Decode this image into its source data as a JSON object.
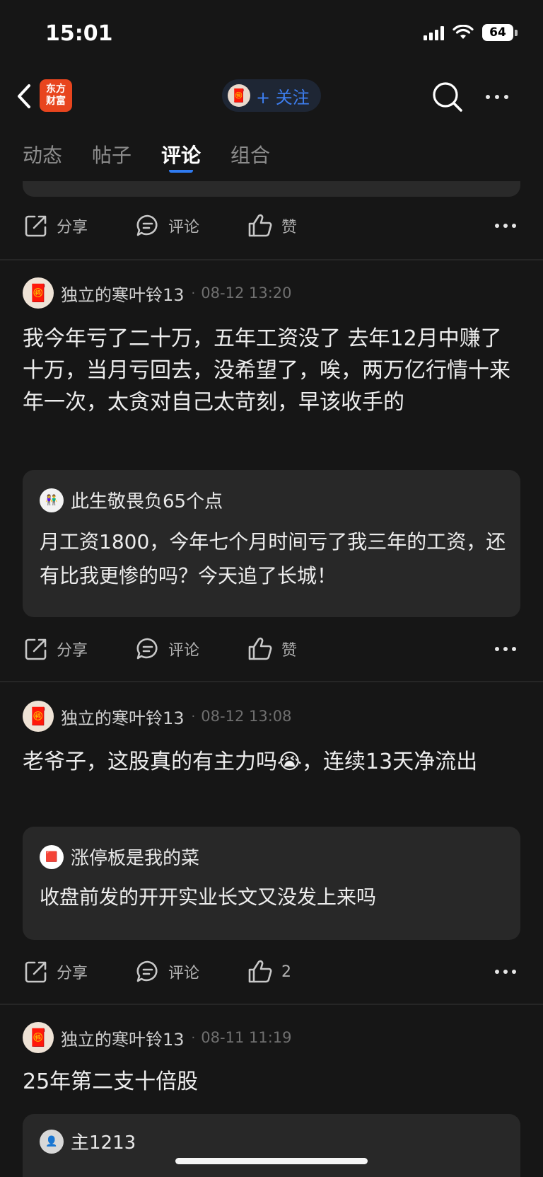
{
  "status_bar": {
    "time": "15:01",
    "battery": "64"
  },
  "nav": {
    "logo_line1": "东方",
    "logo_line2": "财富",
    "follow_label": "+ 关注"
  },
  "tabs": [
    {
      "label": "动态"
    },
    {
      "label": "帖子"
    },
    {
      "label": "评论"
    },
    {
      "label": "组合"
    }
  ],
  "actions": {
    "share": "分享",
    "comment": "评论",
    "like": "赞"
  },
  "posts": [
    {
      "author": "独立的寒叶铃13",
      "time": "08-12 13:20",
      "body": "我今年亏了二十万，五年工资没了 去年12月中赚了十万，当月亏回去，没希望了，唉，两万亿行情十来年一次，太贪对自己太苛刻，早该收手的",
      "quote_author": "此生敬畏负65个点",
      "quote_body": "月工资1800，今年七个月时间亏了我三年的工资，还有比我更惨的吗？今天追了长城！",
      "like_label": "赞"
    },
    {
      "author": "独立的寒叶铃13",
      "time": "08-12 13:08",
      "body": "老爷子，这股真的有主力吗😭，连续13天净流出",
      "quote_author": "涨停板是我的菜",
      "quote_body": "收盘前发的开开实业长文又没发上来吗",
      "like_label": "2"
    },
    {
      "author": "独立的寒叶铃13",
      "time": "08-11 11:19",
      "body": "25年第二支十倍股",
      "quote_author": "主1213"
    }
  ]
}
